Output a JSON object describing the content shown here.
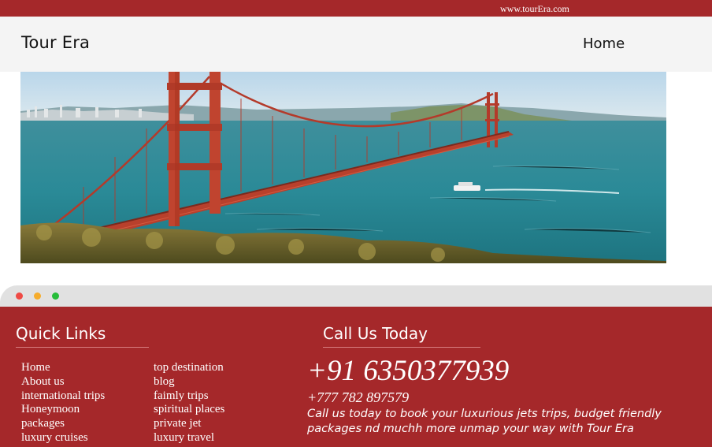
{
  "topbar": {
    "url": "www.tourEra.com"
  },
  "header": {
    "brand": "Tour Era",
    "nav": {
      "home": "Home"
    }
  },
  "hero": {
    "description": "Golden Gate Bridge over blue bay with city skyline and green hills"
  },
  "window_controls": {
    "close_color": "#ef4a45",
    "minimize_color": "#f6ac2c",
    "maximize_color": "#27bd3a"
  },
  "footer": {
    "quick_links_title": "Quick Links",
    "quick_links_col1": [
      "Home",
      "About us",
      "international trips",
      "Honeymoon",
      "packages",
      "luxury cruises"
    ],
    "quick_links_col2": [
      "top destination",
      "blog",
      "faimly trips",
      "spiritual places",
      "private jet",
      "luxury travel"
    ],
    "call_title": "Call Us Today",
    "phone_main": "+91 6350377939",
    "phone_alt": "+777 782 897579",
    "call_text": "Call us today to book your luxurious jets trips, budget friendly packages nd muchh more unmap your way with Tour Era"
  },
  "colors": {
    "brand": "#a5282a",
    "header_bg": "#f4f4f4",
    "chrome_bg": "#e1e1e1"
  }
}
